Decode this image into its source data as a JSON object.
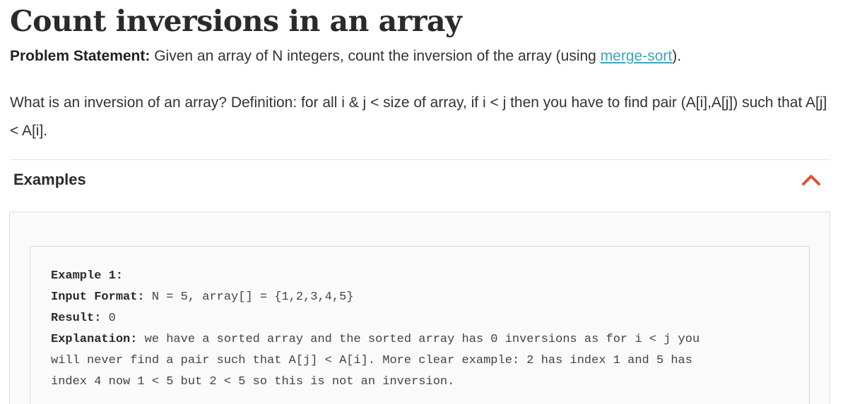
{
  "title": "Count inversions in an array",
  "statement": {
    "label": "Problem Statement:",
    "text_before": " Given an array of N integers, count the inversion of the array (using ",
    "link": "merge-sort",
    "text_after": ")."
  },
  "definition": "What is an inversion of an array? Definition: for all i & j < size of array, if i < j then you have to find pair (A[i],A[j]) such that A[j] < A[i].",
  "examples": {
    "header": "Examples",
    "chevron_icon": "chevron-up-icon",
    "accent_color": "#e0522e",
    "example1": {
      "heading": "Example 1:",
      "input_label": "Input Format:",
      "input_value": " N = 5, array[] = {1,2,3,4,5}",
      "result_label": "Result:",
      "result_value": " 0",
      "explanation_label": "Explanation:",
      "explanation_line1": " we have a sorted array and the sorted array has 0 inversions as for i < j you",
      "explanation_line2": "will never find a pair such that A[j] < A[i]. More clear example: 2 has index 1 and 5 has",
      "explanation_line3": "index 4 now 1 < 5 but 2 < 5 so this is not an inversion."
    }
  }
}
